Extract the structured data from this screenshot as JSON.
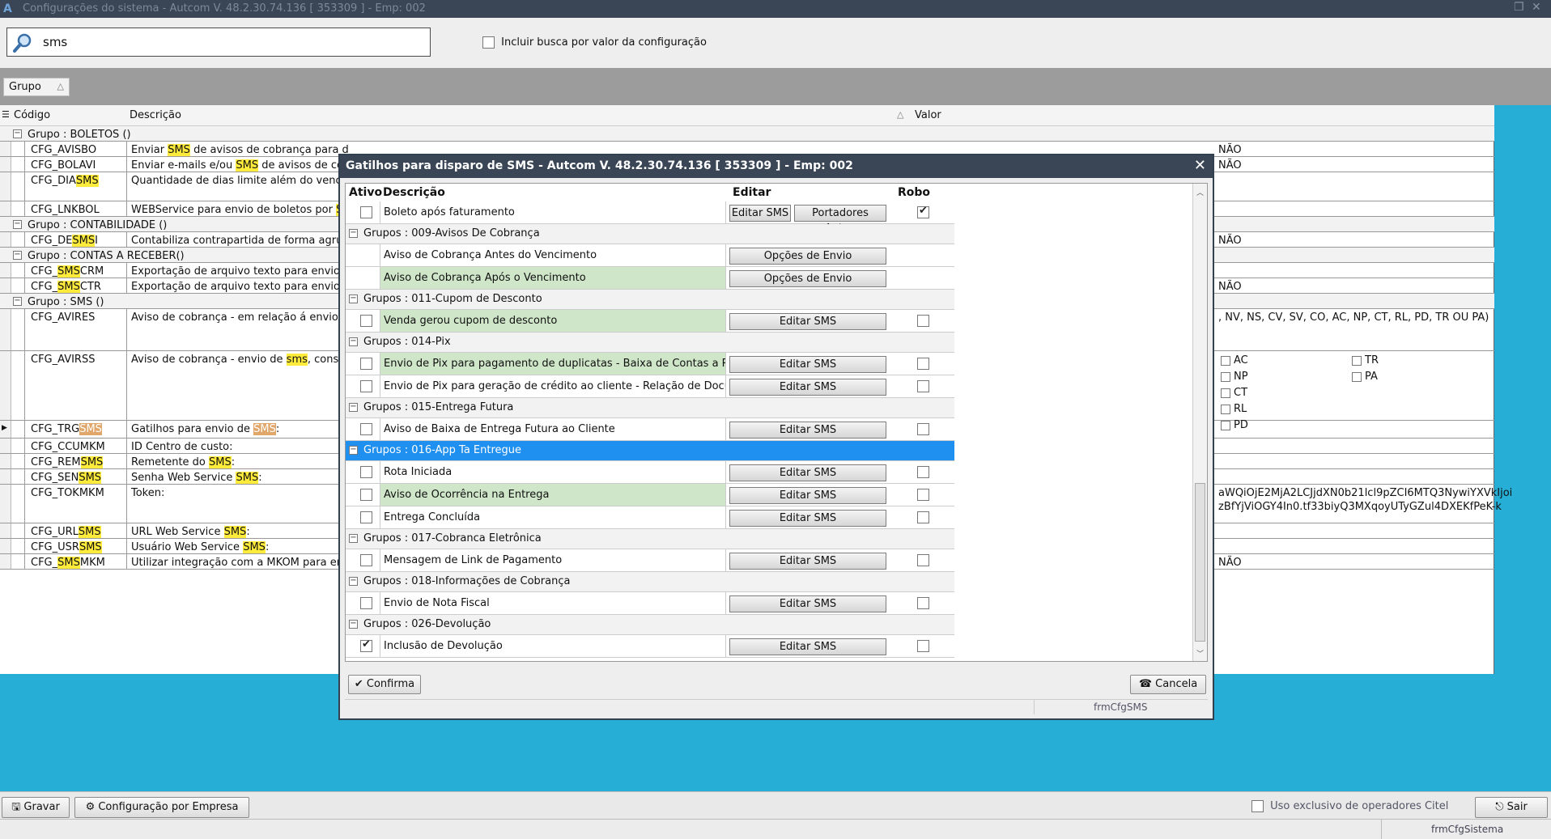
{
  "window": {
    "title": "Configurações do sistema   -   Autcom V. 48.2.30.74.136 [ 353309 ] - Emp: 002"
  },
  "search": {
    "value": "sms",
    "include_value_label": "Incluir busca por valor da configuração"
  },
  "group_chip": {
    "label": "Grupo"
  },
  "grid": {
    "headers": {
      "code": "Código",
      "desc": "Descrição",
      "value": "Valor"
    },
    "rows": [
      {
        "type": "group",
        "label": "Grupo : BOLETOS ()"
      },
      {
        "code": "CFG_AVISBO",
        "desc": "Enviar SMS de avisos de cobrança para d",
        "value": "NÃO"
      },
      {
        "code": "CFG_BOLAVI",
        "desc": "Enviar e-mails e/ou SMS de avisos de cob",
        "value": "NÃO"
      },
      {
        "code": "CFG_DIASMS",
        "desc": "Quantidade de dias limite além do vencime",
        "value": ""
      },
      {
        "code": "CFG_LNKBOL",
        "desc": "WEBService para envio de boletos por SM",
        "value": ""
      },
      {
        "type": "group",
        "label": "Grupo : CONTABILIDADE ()"
      },
      {
        "code": "CFG_DESMSI",
        "desc": "Contabiliza contrapartida de forma agrupa",
        "value": "NÃO"
      },
      {
        "type": "group",
        "label": "Grupo : CONTAS A RECEBER()"
      },
      {
        "code": "CFG_SMSCRM",
        "desc": "Exportação de arquivo texto para envio de",
        "value": ""
      },
      {
        "code": "CFG_SMSCTR",
        "desc": "Exportação de arquivo texto para envio de",
        "value": "NÃO"
      },
      {
        "type": "group",
        "label": "Grupo : SMS ()"
      },
      {
        "code": "CFG_AVIRES",
        "desc": "Aviso de cobrança - em relação á envio d",
        "value": ", NV, NS, CV, SV, CO, AC, NP, CT, RL, PD, TR OU PA)"
      },
      {
        "code": "CFG_AVIRSS",
        "desc": "Aviso de cobrança - envio de sms, consid",
        "value": ""
      },
      {
        "code": "CFG_TRGSMS",
        "desc": "Gatilhos para envio de SMS:",
        "value": ""
      },
      {
        "code": "CFG_CCUMKM",
        "desc": "ID Centro de custo:",
        "value": ""
      },
      {
        "code": "CFG_REMSMS",
        "desc": "Remetente do SMS:",
        "value": ""
      },
      {
        "code": "CFG_SENSMS",
        "desc": "Senha Web Service SMS:",
        "value": ""
      },
      {
        "code": "CFG_TOKMKM",
        "desc": "Token:",
        "value": "aWQiOjE2MjA2LCJjdXN0b21lcl9pZCI6MTQ3NywiYXVkIjoi",
        "value2": "zBfYjViOGY4In0.tf33biyQ3MXqoyUTyGZul4DXEKfPeK-k"
      },
      {
        "code": "CFG_URLSMS",
        "desc": "URL Web Service SMS:",
        "value": ""
      },
      {
        "code": "CFG_USRSMS",
        "desc": "Usuário Web Service SMS:",
        "value": ""
      },
      {
        "code": "CFG_SMSMKM",
        "desc": "Utilizar integração com a MKOM para envi",
        "value": "NÃO"
      }
    ],
    "avirss_options": [
      "AC",
      "NP",
      "CT",
      "RL",
      "PD",
      "TR",
      "PA"
    ]
  },
  "modal": {
    "title": "Gatilhos para disparo de SMS   -   Autcom V. 48.2.30.74.136 [ 353309 ] - Emp: 002",
    "headers": {
      "active": "Ativo",
      "desc": "Descrição",
      "edit": "Editar",
      "robo": "Robo"
    },
    "rows": [
      {
        "type": "item",
        "desc": "Boleto após faturamento",
        "active": false,
        "robo": true,
        "btn1": "Editar SMS",
        "btn2": "Portadores Autor."
      },
      {
        "type": "group",
        "label": "Grupos : 009-Avisos De Cobrança"
      },
      {
        "type": "item",
        "desc": "Aviso de Cobrança Antes do Vencimento",
        "noactive": true,
        "norobo": true,
        "btn": "Opções de Envio"
      },
      {
        "type": "item",
        "desc": "Aviso de Cobrança Após o Vencimento",
        "noactive": true,
        "norobo": true,
        "btn": "Opções de Envio",
        "green": true
      },
      {
        "type": "group",
        "label": "Grupos : 011-Cupom de Desconto"
      },
      {
        "type": "item",
        "desc": "Venda gerou cupom de desconto",
        "active": false,
        "robo": false,
        "btn": "Editar SMS",
        "green": true
      },
      {
        "type": "group",
        "label": "Grupos : 014-Pix"
      },
      {
        "type": "item",
        "desc": "Envio de Pix para pagamento de duplicatas - Baixa de Contas a Receb",
        "active": false,
        "robo": false,
        "btn": "Editar SMS",
        "green": true
      },
      {
        "type": "item",
        "desc": "Envio de Pix para geração de crédito ao cliente - Relação de Documen",
        "active": false,
        "robo": false,
        "btn": "Editar SMS"
      },
      {
        "type": "group",
        "label": "Grupos : 015-Entrega Futura"
      },
      {
        "type": "item",
        "desc": "Aviso de Baixa de Entrega Futura ao Cliente",
        "active": false,
        "robo": false,
        "btn": "Editar SMS"
      },
      {
        "type": "group",
        "label": "Grupos : 016-App Ta Entregue",
        "selected": true
      },
      {
        "type": "item",
        "desc": "Rota Iniciada",
        "active": false,
        "robo": false,
        "btn": "Editar SMS"
      },
      {
        "type": "item",
        "desc": "Aviso de Ocorrência na Entrega",
        "active": false,
        "robo": false,
        "btn": "Editar SMS",
        "green": true
      },
      {
        "type": "item",
        "desc": "Entrega Concluída",
        "active": false,
        "robo": false,
        "btn": "Editar SMS"
      },
      {
        "type": "group",
        "label": "Grupos : 017-Cobranca Eletrônica"
      },
      {
        "type": "item",
        "desc": "Mensagem de Link de Pagamento",
        "active": false,
        "robo": false,
        "btn": "Editar SMS"
      },
      {
        "type": "group",
        "label": "Grupos : 018-Informações de Cobrança"
      },
      {
        "type": "item",
        "desc": "Envio de Nota Fiscal",
        "active": false,
        "robo": false,
        "btn": "Editar SMS"
      },
      {
        "type": "group",
        "label": "Grupos : 026-Devolução"
      },
      {
        "type": "item",
        "desc": "Inclusão de Devolução",
        "active": true,
        "robo": false,
        "btn": "Editar SMS"
      }
    ],
    "confirm_label": "Confirma",
    "cancel_label": "Cancela",
    "form_name": "frmCfgSMS"
  },
  "bottom": {
    "save_label": "Gravar",
    "company_config_label": "Configuração por Empresa",
    "exclusive_label": "Uso exclusivo de operadores Citel",
    "exit_label": "Sair",
    "form_name": "frmCfgSistema"
  },
  "colors": {
    "background": "#26aed6",
    "titlebar": "#3a4656",
    "selection": "#1f8ff0",
    "highlight": "#ffeb3b",
    "green_row": "#cfe6c9"
  }
}
